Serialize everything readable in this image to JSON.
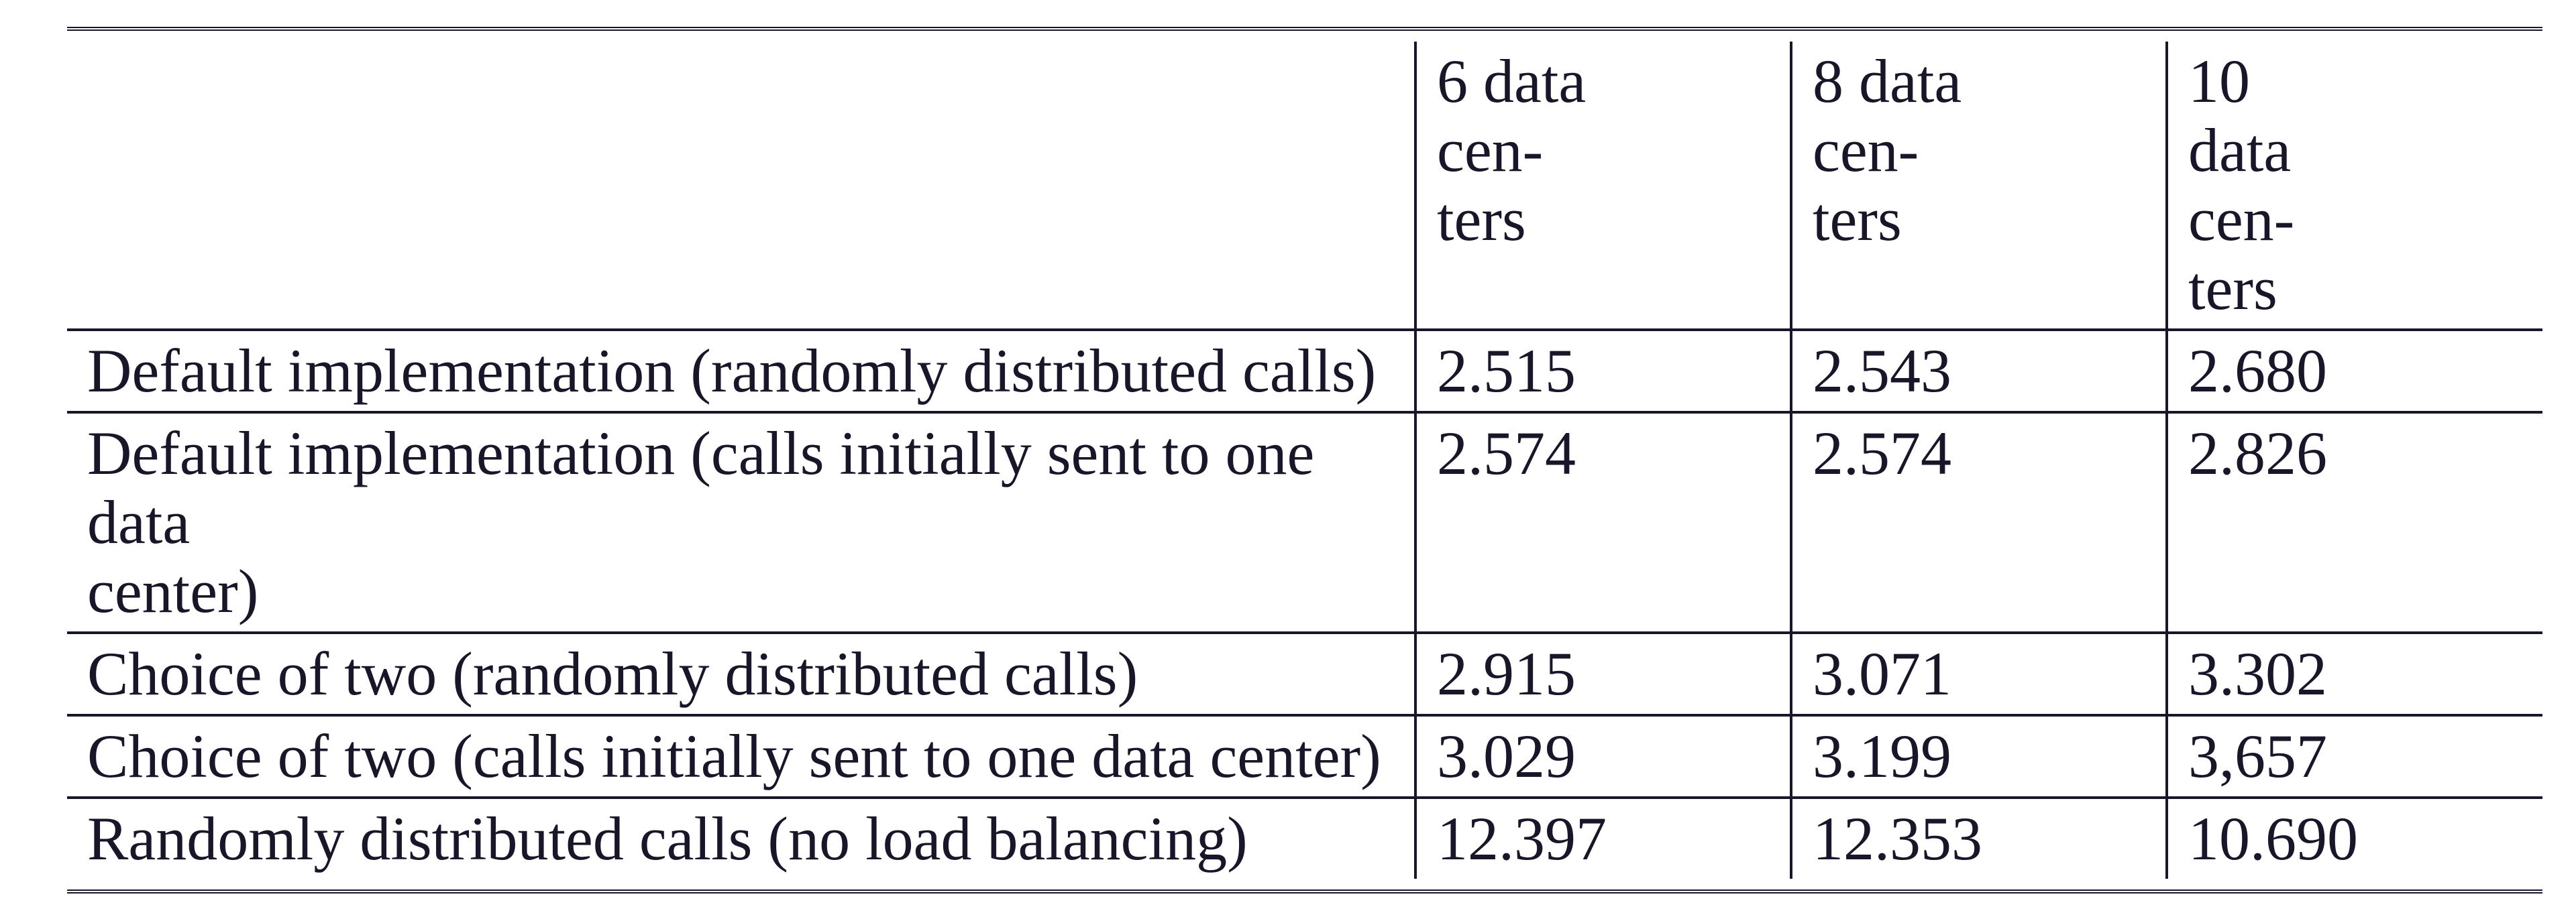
{
  "chart_data": {
    "type": "table",
    "columns": [
      "6 data centers",
      "8 data centers",
      "10 data centers"
    ],
    "rows": [
      {
        "label": "Default implementation (randomly distributed calls)",
        "values": [
          "2.515",
          "2.543",
          "2.680"
        ]
      },
      {
        "label": "Default implementation (calls initially sent to one data center)",
        "values": [
          "2.574",
          "2.574",
          "2.826"
        ]
      },
      {
        "label": "Choice of two (randomly distributed calls)",
        "values": [
          "2.915",
          "3.071",
          "3.302"
        ]
      },
      {
        "label": "Choice of two (calls initially sent to one data center)",
        "values": [
          "3.029",
          "3.199",
          "3,657"
        ]
      },
      {
        "label": "Randomly distributed calls (no load balancing)",
        "values": [
          "12.397",
          "12.353",
          "10.690"
        ]
      }
    ]
  },
  "header": {
    "col1": {
      "line1": "6 data",
      "line2": "cen-",
      "line3": "ters"
    },
    "col2": {
      "line1": "8 data",
      "line2": "cen-",
      "line3": "ters"
    },
    "col3": {
      "line1": "10",
      "line2": "data",
      "line3": "cen-",
      "line4": "ters"
    }
  },
  "rows": {
    "r0": {
      "label": "Default implementation (randomly distributed calls)",
      "v1": "2.515",
      "v2": "2.543",
      "v3": "2.680"
    },
    "r1": {
      "label_l1": "Default implementation (calls initially sent to one data",
      "label_l2": "center)",
      "v1": "2.574",
      "v2": "2.574",
      "v3": "2.826"
    },
    "r2": {
      "label": "Choice of two (randomly distributed calls)",
      "v1": "2.915",
      "v2": "3.071",
      "v3": "3.302"
    },
    "r3": {
      "label": "Choice of two (calls initially sent to one data center)",
      "v1": "3.029",
      "v2": "3.199",
      "v3": "3,657"
    },
    "r4": {
      "label": "Randomly distributed calls (no load balancing)",
      "v1": "12.397",
      "v2": "12.353",
      "v3": "10.690"
    }
  }
}
